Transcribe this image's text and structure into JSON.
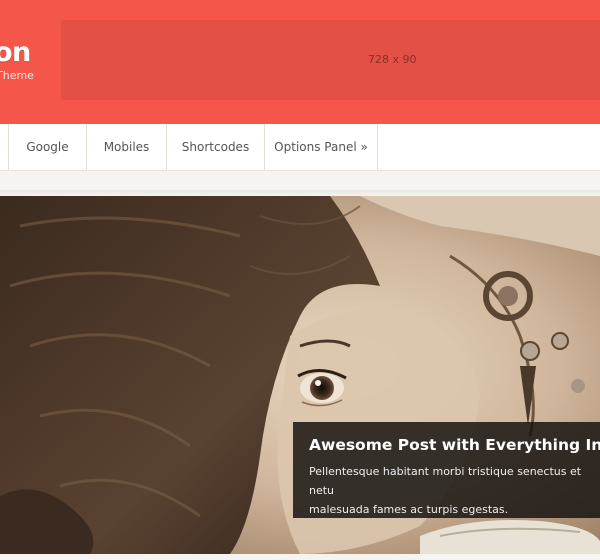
{
  "header": {
    "logo_title": "on",
    "logo_tagline": "Theme",
    "ad_label": "728 x 90"
  },
  "nav": {
    "items": [
      {
        "label": "Google"
      },
      {
        "label": "Mobiles"
      },
      {
        "label": "Shortcodes"
      },
      {
        "label": "Options Panel »"
      }
    ]
  },
  "slider": {
    "title": "Awesome Post with Everything In It",
    "excerpt": "Pellentesque habitant morbi tristique senectus et netu\nmalesuada fames ac turpis egestas."
  },
  "colors": {
    "header_bg": "#f4564a",
    "ad_bg": "#e35046",
    "nav_text": "#555555",
    "caption_bg": "#16120f"
  }
}
